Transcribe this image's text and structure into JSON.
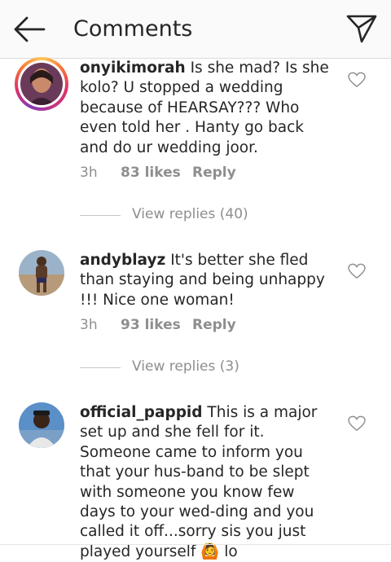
{
  "header": {
    "title": "Comments"
  },
  "comments": [
    {
      "username": "onyikimorah",
      "text": "Is she mad? Is she kolo? U stopped a wedding because of HEARSAY??? Who even told her . Hanty go back and do ur wedding joor.",
      "time": "3h",
      "likes": "83 likes",
      "reply": "Reply",
      "view_replies": "View replies (40)"
    },
    {
      "username": "andyblayz",
      "text": "It's better she fled than staying and being unhappy !!! Nice one woman!",
      "time": "3h",
      "likes": "93 likes",
      "reply": "Reply",
      "view_replies": "View replies (3)"
    },
    {
      "username": "official_pappid",
      "text": "This is a major set up and she fell for it. Someone came to inform you that your hus-band to be slept with someone you know few days to your wed-ding and you called it off...sorry sis you just played yourself 🙆 lo",
      "time": "",
      "likes": "",
      "reply": "",
      "view_replies": ""
    }
  ],
  "icons": {
    "back": "arrow-left-icon",
    "send": "paper-plane-icon",
    "like": "heart-outline-icon"
  },
  "colors": {
    "text": "#262626",
    "meta": "#8e8e8e",
    "header_bg": "#fafafa",
    "story_ring": "#e1306c"
  }
}
